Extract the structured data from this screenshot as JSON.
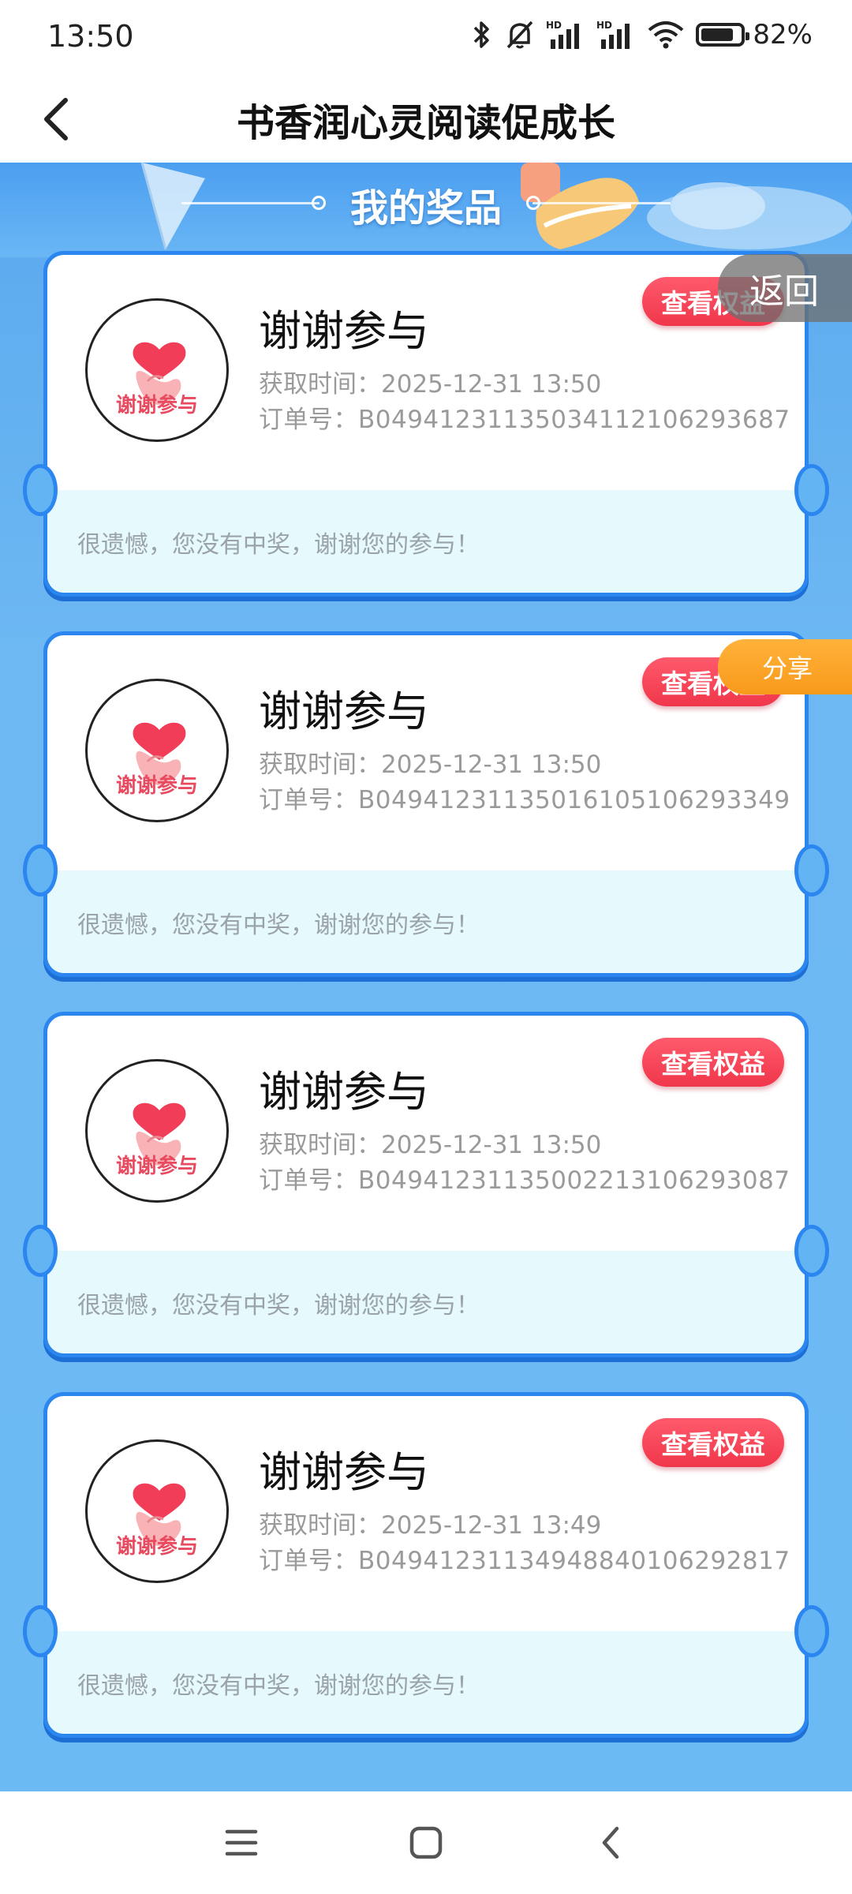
{
  "status_bar": {
    "time": "13:50",
    "battery": "82%",
    "battery_level": 0.82,
    "icons": [
      "bluetooth-icon",
      "mute-icon",
      "signal-hd-icon",
      "signal-hd-icon",
      "wifi-icon",
      "battery-icon"
    ]
  },
  "header": {
    "title": "书香润心灵阅读促成长",
    "back_icon": "chevron-left-icon"
  },
  "banner": {
    "title": "我的奖品"
  },
  "prizes": [
    {
      "name": "谢谢参与",
      "time": "获取时间：2025-12-31 13:50",
      "order": "订单号：B04941231135034112106293687",
      "message": "很遗憾，您没有中奖，谢谢您的参与！",
      "button": "查看权益",
      "badge_text": "谢谢参与"
    },
    {
      "name": "谢谢参与",
      "time": "获取时间：2025-12-31 13:50",
      "order": "订单号：B04941231135016105106293349",
      "message": "很遗憾，您没有中奖，谢谢您的参与！",
      "button": "查看权益",
      "badge_text": "谢谢参与"
    },
    {
      "name": "谢谢参与",
      "time": "获取时间：2025-12-31 13:50",
      "order": "订单号：B04941231135002213106293087",
      "message": "很遗憾，您没有中奖，谢谢您的参与！",
      "button": "查看权益",
      "badge_text": "谢谢参与"
    },
    {
      "name": "谢谢参与",
      "time": "获取时间：2025-12-31 13:49",
      "order": "订单号：B04941231134948840106292817",
      "message": "很遗憾，您没有中奖，谢谢您的参与！",
      "button": "查看权益",
      "badge_text": "谢谢参与"
    }
  ],
  "floating": {
    "return_label": "返回",
    "share_label": "分享"
  },
  "nav": {
    "icons": [
      "menu-icon",
      "home-icon",
      "back-icon"
    ]
  },
  "colors": {
    "accent_blue": "#2b86ef",
    "background_blue": "#6cbaf4",
    "button_red": "#f0364a",
    "share_orange": "#f89a1c"
  }
}
